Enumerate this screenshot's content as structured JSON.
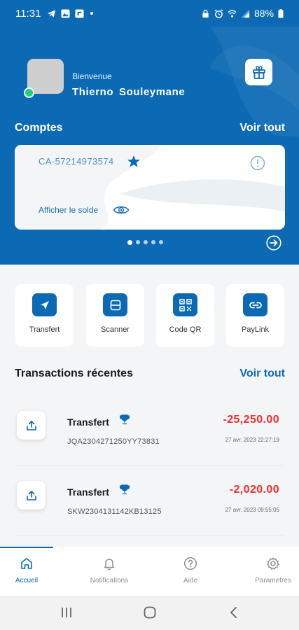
{
  "status_bar": {
    "time": "11:31",
    "battery": "88%"
  },
  "header": {
    "welcome": "Bienvenue",
    "user_name": "Thierno  Souleymane",
    "accounts_title": "Comptes",
    "see_all": "Voir tout"
  },
  "account_card": {
    "number": "CA-57214973574",
    "show_balance": "Afficher le solde",
    "carousel_pages": 5,
    "carousel_active": 1
  },
  "quick_actions": [
    {
      "label": "Transfert",
      "icon": "send-icon"
    },
    {
      "label": "Scanner",
      "icon": "scan-icon"
    },
    {
      "label": "Code QR",
      "icon": "qr-code-icon"
    },
    {
      "label": "PayLink",
      "icon": "link-icon"
    }
  ],
  "transactions": {
    "title": "Transactions récentes",
    "see_all": "Voir tout",
    "items": [
      {
        "type": "Transfert",
        "reference": "JQA2304271250YY73831",
        "amount": "-25,250.00",
        "date": "27 avr. 2023  22:27:19"
      },
      {
        "type": "Transfert",
        "reference": "SKW2304131142KB13125",
        "amount": "-2,020.00",
        "date": "27 avr. 2023  09:55:05"
      }
    ]
  },
  "bottom_nav": [
    {
      "label": "Accueil",
      "icon": "home-icon",
      "active": true
    },
    {
      "label": "Notifications",
      "icon": "bell-icon",
      "active": false
    },
    {
      "label": "Aide",
      "icon": "help-icon",
      "active": false
    },
    {
      "label": "Parametres",
      "icon": "gear-icon",
      "active": false
    }
  ],
  "colors": {
    "primary": "#0c6ab4",
    "negative_amount": "#ef2d2d",
    "online": "#1ed078"
  }
}
